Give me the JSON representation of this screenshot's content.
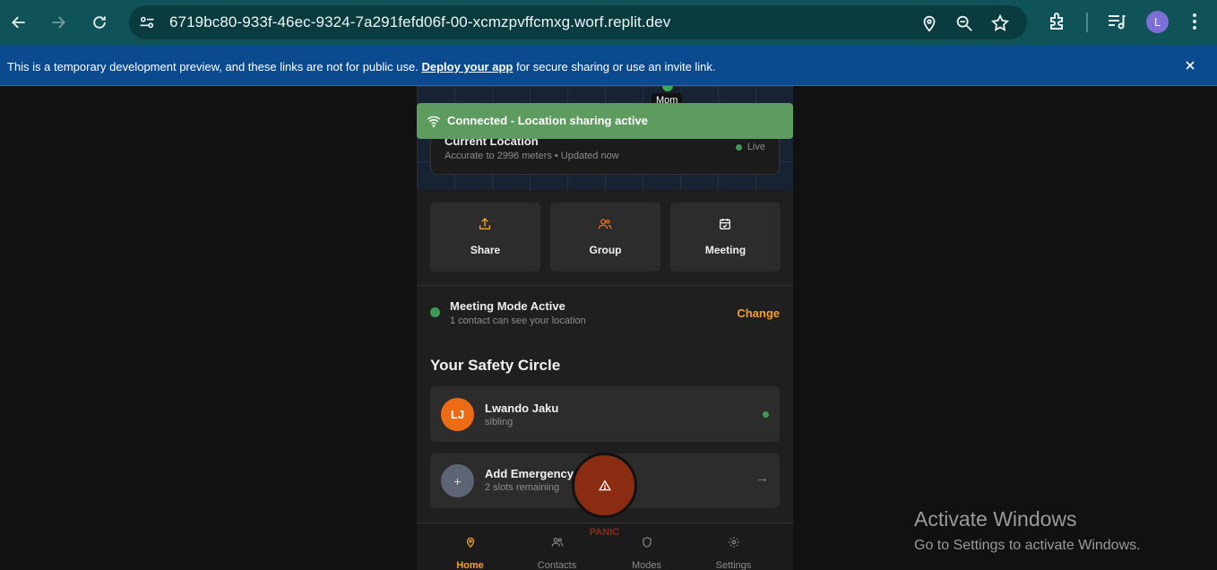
{
  "browser": {
    "url": "6719bc80-933f-46ec-9324-7a291fefd06f-00-xcmzpvffcmxg.worf.replit.dev",
    "profile_initial": "L"
  },
  "infobar": {
    "text_before": "This is a temporary development preview, and these links are not for public use.",
    "link": "Deploy your app",
    "text_after": "for secure sharing or use an invite link."
  },
  "map": {
    "pin_label": "Mom"
  },
  "toast": {
    "text": "Connected - Location sharing active"
  },
  "location": {
    "title": "Current Location",
    "subtitle": "Accurate to 2996 meters • Updated now",
    "status": "Live"
  },
  "actions": [
    {
      "label": "Share"
    },
    {
      "label": "Group"
    },
    {
      "label": "Meeting"
    }
  ],
  "mode": {
    "title": "Meeting Mode Active",
    "subtitle": "1 contact can see your location",
    "change_label": "Change"
  },
  "safety_circle": {
    "title": "Your Safety Circle",
    "contacts": [
      {
        "initials": "LJ",
        "name": "Lwando Jaku",
        "relation": "sibling"
      }
    ],
    "add": {
      "symbol": "+",
      "title": "Add Emergency",
      "subtitle": "2 slots remaining",
      "arrow": "→"
    }
  },
  "panic": {
    "label": "PANIC"
  },
  "nav": [
    {
      "label": "Home"
    },
    {
      "label": "Contacts"
    },
    {
      "label": "Modes"
    },
    {
      "label": "Settings"
    }
  ],
  "colors": {
    "accent": "#f2a12b",
    "online": "#3f9a55",
    "toast": "#5d9b5f",
    "panic": "#8a2c12",
    "avatar": "#ee6b16"
  },
  "watermark": {
    "title": "Activate Windows",
    "subtitle": "Go to Settings to activate Windows."
  }
}
